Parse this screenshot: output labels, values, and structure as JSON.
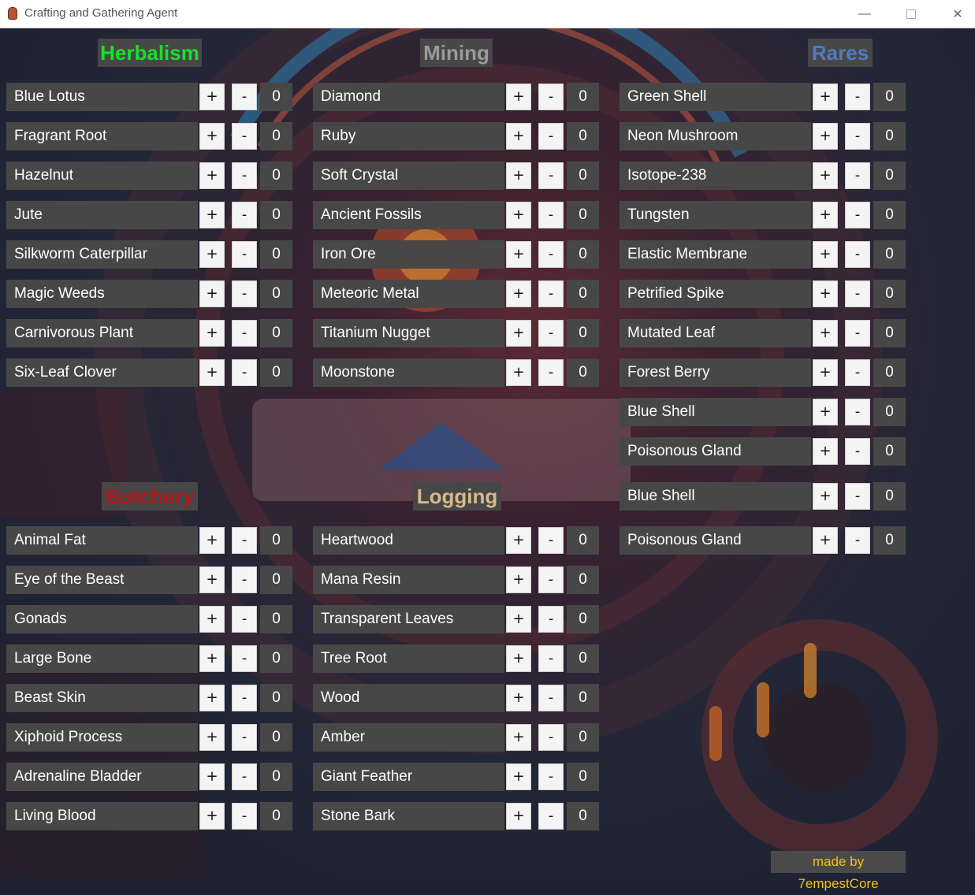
{
  "window": {
    "title": "Crafting and Gathering Agent",
    "minimize_glyph": "—",
    "close_glyph": "✕",
    "app_icon": "potion-icon"
  },
  "colors": {
    "herbalism": "#19e02a",
    "mining": "#9a9a9a",
    "rares": "#4f7cc0",
    "butchery": "#b21a1a",
    "logging": "#d8b98a",
    "credit": "#f2c21b",
    "box_bg": "#474747"
  },
  "buttons": {
    "plus": "+",
    "minus": "-"
  },
  "categories": {
    "herbalism": {
      "title": "Herbalism",
      "items": [
        {
          "name": "Blue Lotus",
          "count": "0"
        },
        {
          "name": "Fragrant Root",
          "count": "0"
        },
        {
          "name": "Hazelnut",
          "count": "0"
        },
        {
          "name": "Jute",
          "count": "0"
        },
        {
          "name": "Silkworm Caterpillar",
          "count": "0"
        },
        {
          "name": "Magic Weeds",
          "count": "0"
        },
        {
          "name": "Carnivorous Plant",
          "count": "0"
        },
        {
          "name": "Six-Leaf Clover",
          "count": "0"
        }
      ]
    },
    "mining": {
      "title": "Mining",
      "items": [
        {
          "name": "Diamond",
          "count": "0"
        },
        {
          "name": "Ruby",
          "count": "0"
        },
        {
          "name": "Soft Crystal",
          "count": "0"
        },
        {
          "name": "Ancient Fossils",
          "count": "0"
        },
        {
          "name": "Iron Ore",
          "count": "0"
        },
        {
          "name": "Meteoric Metal",
          "count": "0"
        },
        {
          "name": "Titanium Nugget",
          "count": "0"
        },
        {
          "name": "Moonstone",
          "count": "0"
        }
      ]
    },
    "rares": {
      "title": "Rares",
      "items": [
        {
          "name": "Green Shell",
          "count": "0"
        },
        {
          "name": "Neon Mushroom",
          "count": "0"
        },
        {
          "name": "Isotope-238",
          "count": "0"
        },
        {
          "name": "Tungsten",
          "count": "0"
        },
        {
          "name": "Elastic Membrane",
          "count": "0"
        },
        {
          "name": "Petrified Spike",
          "count": "0"
        },
        {
          "name": "Mutated Leaf",
          "count": "0"
        },
        {
          "name": "Forest Berry",
          "count": "0"
        },
        {
          "name": "Blue Shell",
          "count": "0"
        },
        {
          "name": "Poisonous Gland",
          "count": "0"
        },
        {
          "name": "Blue Shell",
          "count": "0"
        },
        {
          "name": "Poisonous Gland",
          "count": "0"
        }
      ]
    },
    "butchery": {
      "title": "Butchery",
      "items": [
        {
          "name": "Animal Fat",
          "count": "0"
        },
        {
          "name": "Eye of the Beast",
          "count": "0"
        },
        {
          "name": "Gonads",
          "count": "0"
        },
        {
          "name": "Large Bone",
          "count": "0"
        },
        {
          "name": "Beast Skin",
          "count": "0"
        },
        {
          "name": "Xiphoid Process",
          "count": "0"
        },
        {
          "name": "Adrenaline Bladder",
          "count": "0"
        },
        {
          "name": "Living Blood",
          "count": "0"
        }
      ]
    },
    "logging": {
      "title": "Logging",
      "items": [
        {
          "name": "Heartwood",
          "count": "0"
        },
        {
          "name": "Mana Resin",
          "count": "0"
        },
        {
          "name": "Transparent Leaves",
          "count": "0"
        },
        {
          "name": "Tree Root",
          "count": "0"
        },
        {
          "name": "Wood",
          "count": "0"
        },
        {
          "name": "Amber",
          "count": "0"
        },
        {
          "name": "Giant Feather",
          "count": "0"
        },
        {
          "name": "Stone Bark",
          "count": "0"
        }
      ]
    }
  },
  "footer": {
    "credit": "made by 7empestCore"
  }
}
